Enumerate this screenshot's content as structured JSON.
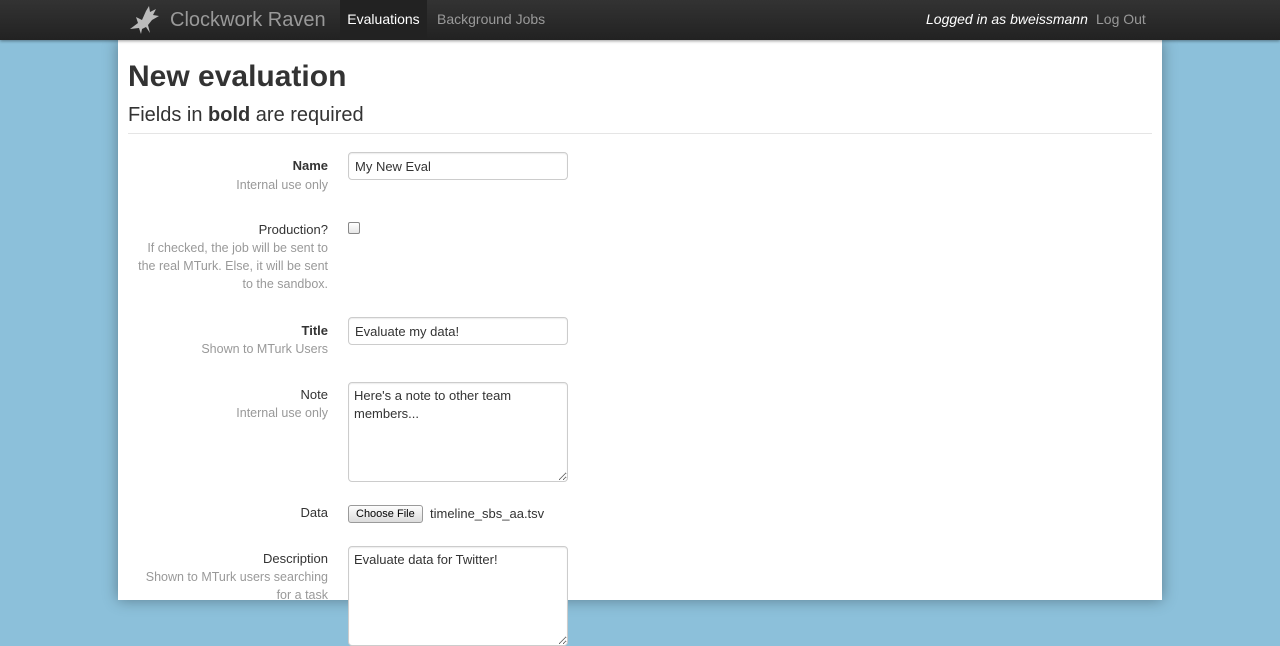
{
  "navbar": {
    "brand": "Clockwork Raven",
    "brand_icon": "raven-logo-icon",
    "items": [
      {
        "label": "Evaluations",
        "active": true
      },
      {
        "label": "Background Jobs",
        "active": false
      }
    ],
    "logged_in": "Logged in as bweissmann",
    "logout": "Log Out"
  },
  "page": {
    "title": "New evaluation",
    "subtitle_prefix": "Fields in ",
    "subtitle_bold": "bold",
    "subtitle_suffix": " are required"
  },
  "form": {
    "name": {
      "label": "Name",
      "help": "Internal use only",
      "value": "My New Eval"
    },
    "production": {
      "label": "Production?",
      "help": "If checked, the job will be sent to the real MTurk. Else, it will be sent to the sandbox.",
      "checked": false
    },
    "title": {
      "label": "Title",
      "help": "Shown to MTurk Users",
      "value": "Evaluate my data!"
    },
    "note": {
      "label": "Note",
      "help": "Internal use only",
      "value": "Here's a note to other team members..."
    },
    "data": {
      "label": "Data",
      "button": "Choose File",
      "file": "timeline_sbs_aa.tsv"
    },
    "description": {
      "label": "Description",
      "help": "Shown to MTurk users searching for a task",
      "value": "Evaluate data for Twitter!"
    }
  },
  "colors": {
    "background": "#8cc0da",
    "navbar": "#222222",
    "help_text": "#999999"
  }
}
